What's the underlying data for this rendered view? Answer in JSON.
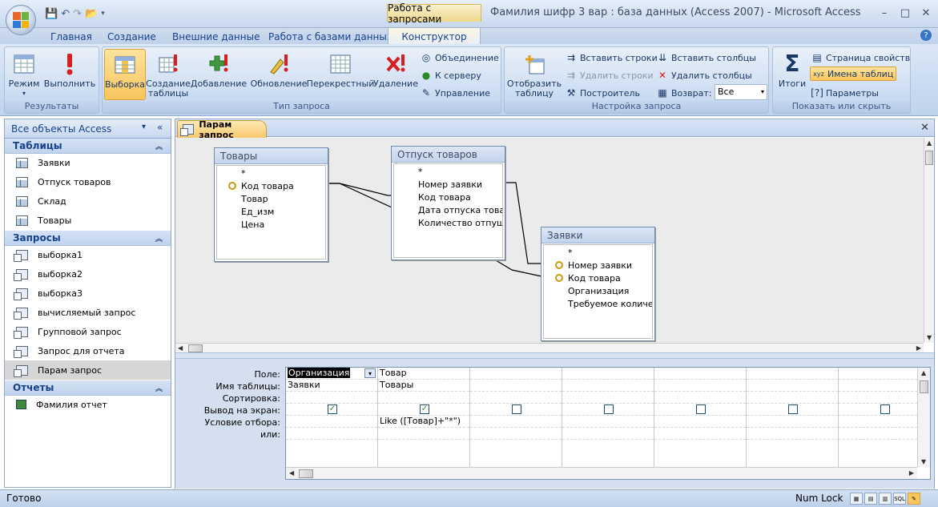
{
  "window": {
    "title": "Фамилия шифр 3 вар : база данных (Access 2007) - Microsoft Access",
    "context_tab_group": "Работа с запросами",
    "minimize": "–",
    "maximize": "□",
    "close": "✕"
  },
  "ribbon_tabs": [
    "Главная",
    "Создание",
    "Внешние данные",
    "Работа с базами данных",
    "Конструктор"
  ],
  "ribbon": {
    "results": {
      "label": "Результаты",
      "mode": "Режим",
      "run": "Выполнить"
    },
    "query_type": {
      "label": "Тип запроса",
      "select": "Выборка",
      "make_table": "Создание таблицы",
      "append": "Добавление",
      "update": "Обновление",
      "crosstab": "Перекрестный",
      "delete": "Удаление",
      "union": "Объединение",
      "passthrough": "К серверу",
      "data_definition": "Управление"
    },
    "query_setup": {
      "label": "Настройка запроса",
      "show_table": "Отобразить таблицу",
      "insert_rows": "Вставить строки",
      "delete_rows": "Удалить строки",
      "builder": "Построитель",
      "insert_columns": "Вставить столбцы",
      "delete_columns": "Удалить столбцы",
      "return_label": "Возврат:",
      "return_value": "Все"
    },
    "show_hide": {
      "label": "Показать или скрыть",
      "totals": "Итоги",
      "property_sheet": "Страница свойств",
      "table_names": "Имена таблиц",
      "parameters": "Параметры"
    }
  },
  "nav": {
    "header": "Все объекты Access",
    "sections": [
      {
        "title": "Таблицы",
        "items": [
          "Заявки",
          "Отпуск товаров",
          "Склад",
          "Товары"
        ]
      },
      {
        "title": "Запросы",
        "items": [
          "выборка1",
          "выборка2",
          "выборка3",
          "вычисляемый запрос",
          "Групповой запрос",
          "Запрос для отчета",
          "Парам запрос"
        ]
      },
      {
        "title": "Отчеты",
        "items": [
          "Фамилия отчет"
        ]
      }
    ]
  },
  "document": {
    "tab": "Парам запрос"
  },
  "tables": [
    {
      "name": "Товары",
      "fields": [
        "*",
        "Код товара",
        "Товар",
        "Ед_изм",
        "Цена"
      ],
      "keys": [
        1
      ]
    },
    {
      "name": "Отпуск товаров",
      "fields": [
        "*",
        "Номер заявки",
        "Код товара",
        "Дата отпуска товара",
        "Количество отпуще"
      ],
      "keys": []
    },
    {
      "name": "Заявки",
      "fields": [
        "*",
        "Номер заявки",
        "Код товара",
        "Организация",
        "Требуемое количес"
      ],
      "keys": [
        1,
        2
      ]
    }
  ],
  "grid": {
    "row_labels": [
      "Поле:",
      "Имя таблицы:",
      "Сортировка:",
      "Вывод на экран:",
      "Условие отбора:",
      "или:"
    ],
    "columns": [
      {
        "field": "Организация",
        "table": "Заявки",
        "sort": "",
        "show": true,
        "criteria": "",
        "or": ""
      },
      {
        "field": "Товар",
        "table": "Товары",
        "sort": "",
        "show": true,
        "criteria": "Like ([Товар]+\"*\")",
        "or": ""
      },
      {
        "field": "",
        "table": "",
        "sort": "",
        "show": false,
        "criteria": "",
        "or": ""
      },
      {
        "field": "",
        "table": "",
        "sort": "",
        "show": false,
        "criteria": "",
        "or": ""
      },
      {
        "field": "",
        "table": "",
        "sort": "",
        "show": false,
        "criteria": "",
        "or": ""
      },
      {
        "field": "",
        "table": "",
        "sort": "",
        "show": false,
        "criteria": "",
        "or": ""
      },
      {
        "field": "",
        "table": "",
        "sort": "",
        "show": false,
        "criteria": "",
        "or": ""
      }
    ]
  },
  "status": {
    "text": "Готово",
    "numlock": "Num Lock"
  },
  "colors": {
    "accent": "#15428b",
    "selected": "#f9c55d",
    "ribbon": "#c9dbf1"
  }
}
